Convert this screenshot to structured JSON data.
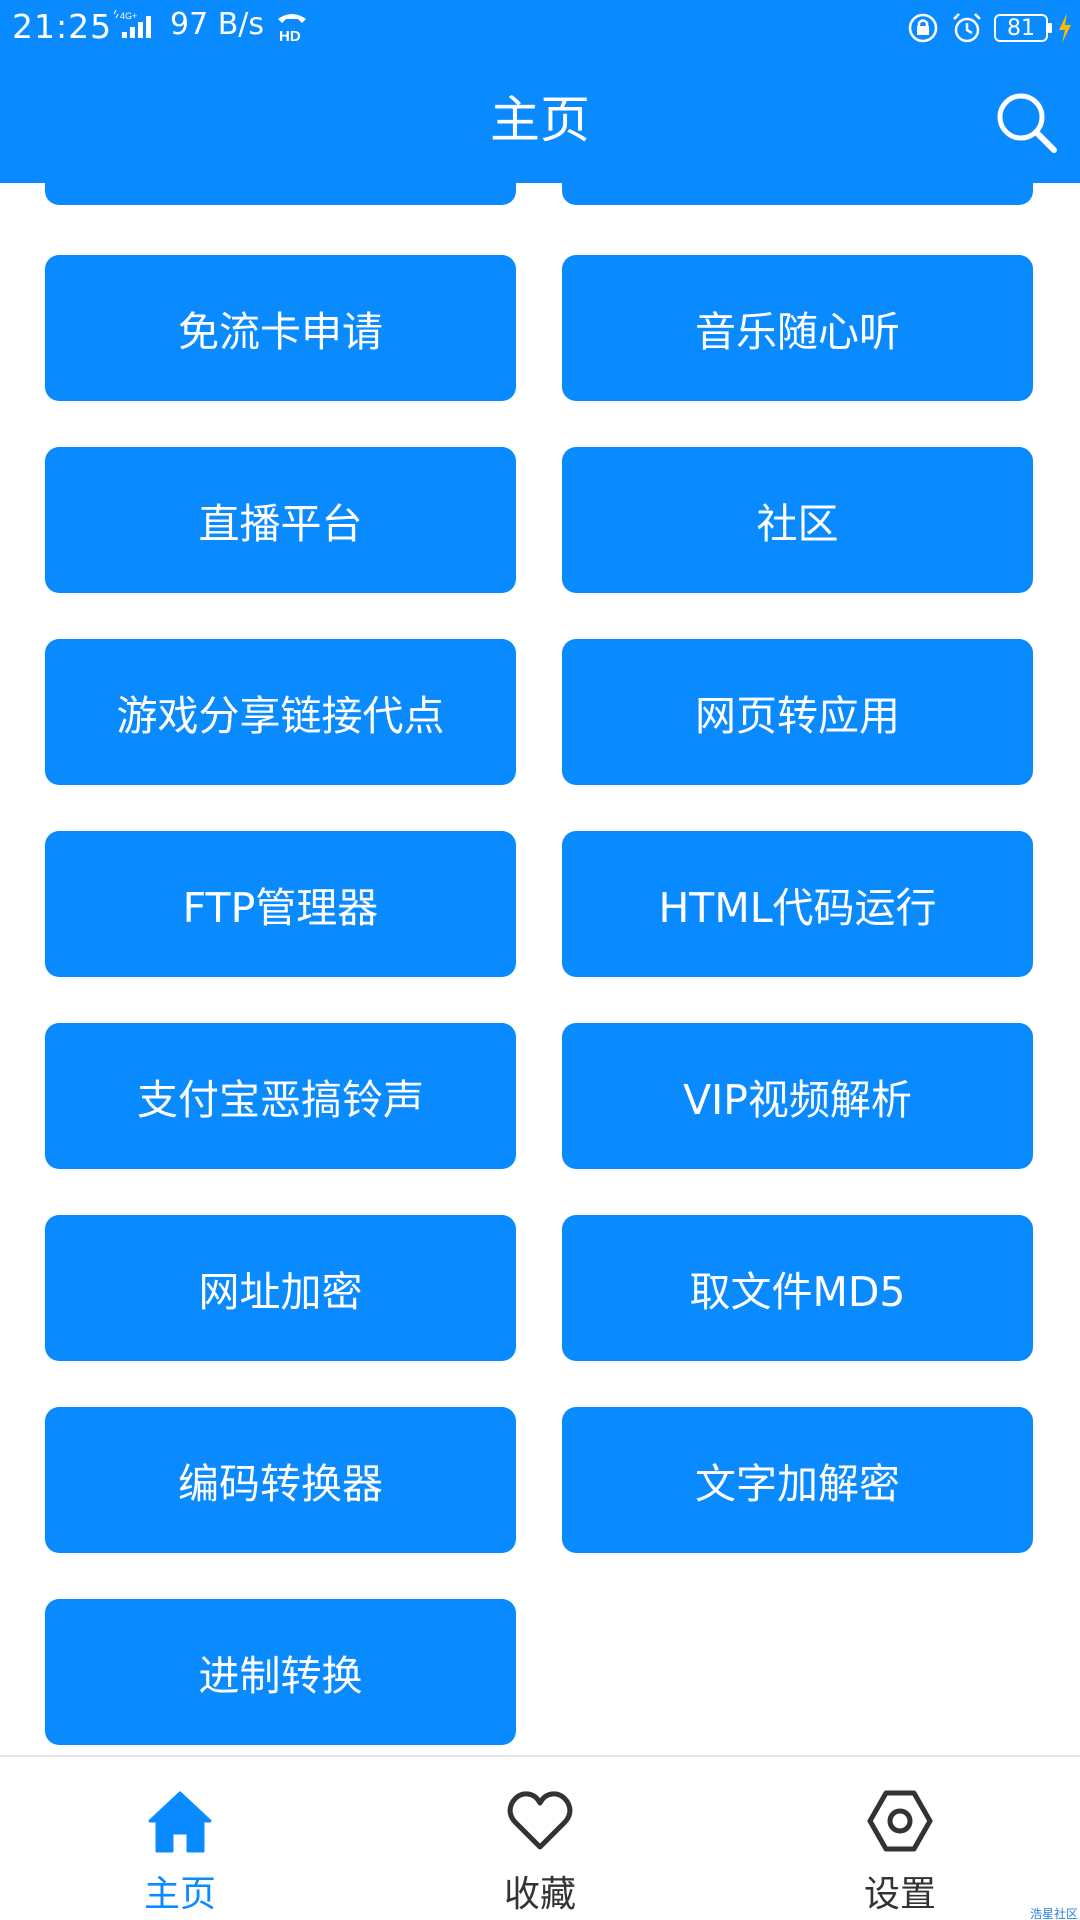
{
  "status_bar": {
    "time": "21:25",
    "network_type": "4G+",
    "net_speed": "97 B/s",
    "hd_badge": "HD",
    "battery": "81"
  },
  "app_bar": {
    "title": "主页",
    "search_icon": "search-icon"
  },
  "tiles": [
    {
      "label": "免流卡申请"
    },
    {
      "label": "音乐随心听"
    },
    {
      "label": "直播平台"
    },
    {
      "label": "社区"
    },
    {
      "label": "游戏分享链接代点"
    },
    {
      "label": "网页转应用"
    },
    {
      "label": "FTP管理器"
    },
    {
      "label": "HTML代码运行"
    },
    {
      "label": "支付宝恶搞铃声"
    },
    {
      "label": "VIP视频解析"
    },
    {
      "label": "网址加密"
    },
    {
      "label": "取文件MD5"
    },
    {
      "label": "编码转换器"
    },
    {
      "label": "文字加解密"
    },
    {
      "label": "进制转换"
    }
  ],
  "bottom_nav": [
    {
      "label": "主页",
      "icon": "home-icon",
      "active": true
    },
    {
      "label": "收藏",
      "icon": "heart-icon",
      "active": false
    },
    {
      "label": "设置",
      "icon": "settings-icon",
      "active": false
    }
  ],
  "watermark": "浩星社区",
  "colors": {
    "primary": "#0a8aff",
    "text_on_primary": "#ffffff",
    "nav_inactive": "#333333"
  }
}
